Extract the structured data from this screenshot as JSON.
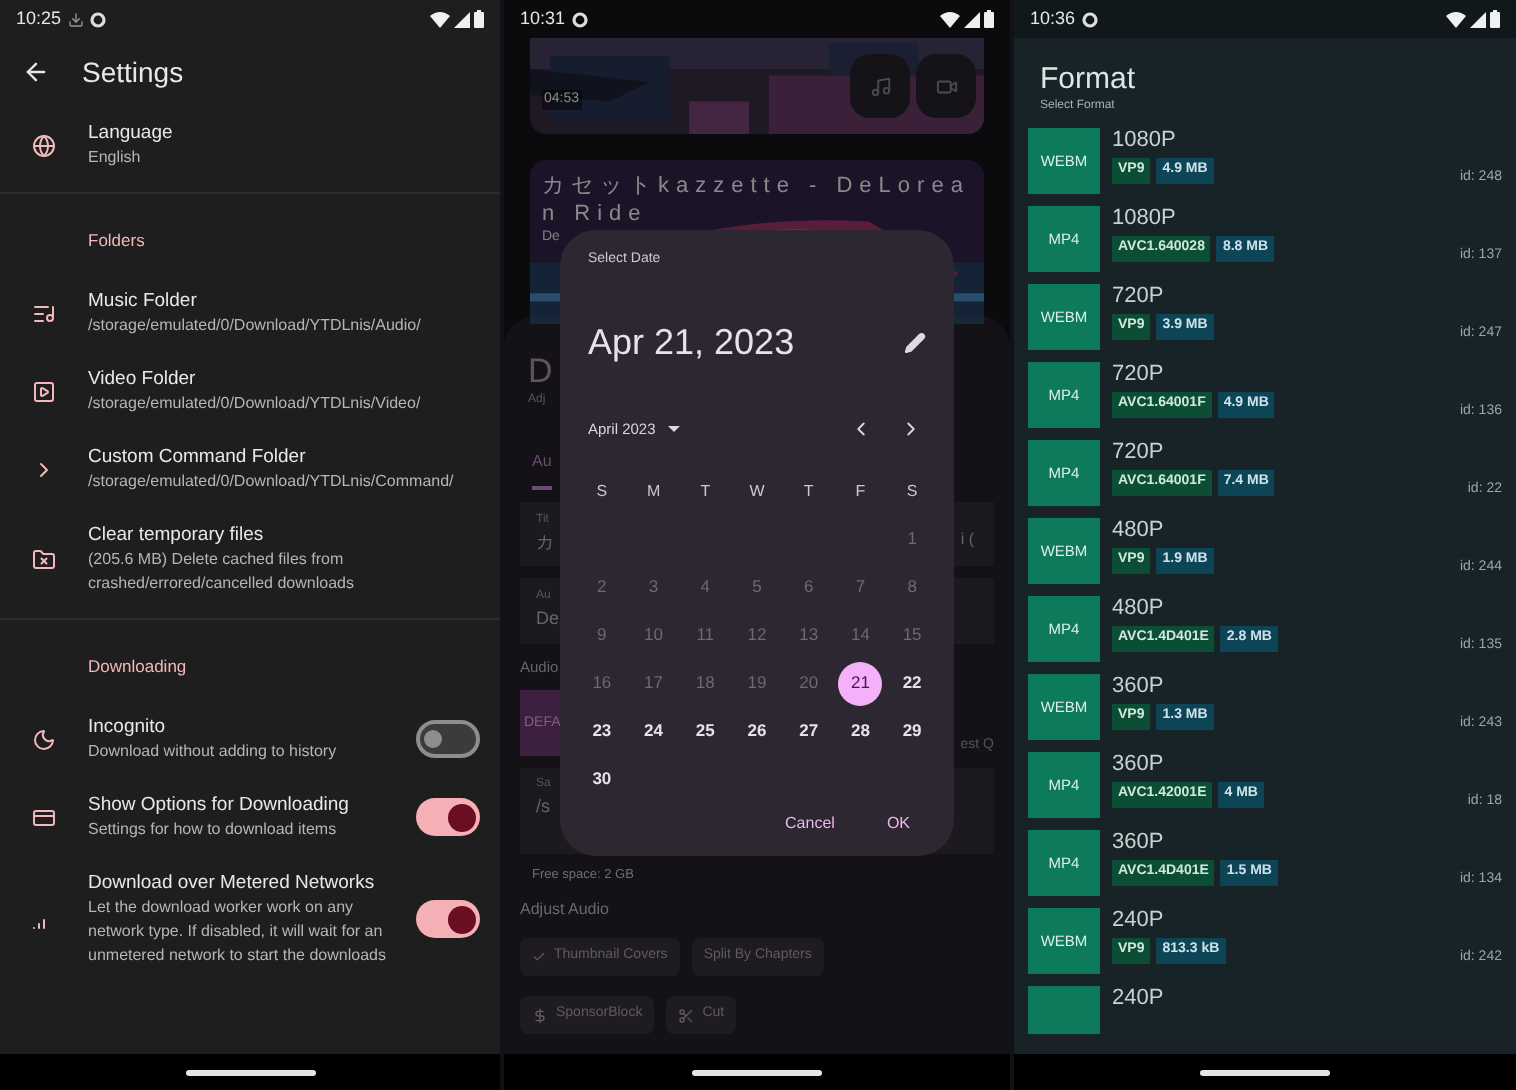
{
  "settings": {
    "time": "10:25",
    "title": "Settings",
    "items": [
      {
        "kind": "pref",
        "title": "Language",
        "subtitle": "English"
      },
      {
        "kind": "header",
        "title": "Folders"
      },
      {
        "kind": "pref",
        "title": "Music Folder",
        "subtitle": "/storage/emulated/0/Download/YTDLnis/Audio/"
      },
      {
        "kind": "pref",
        "title": "Video Folder",
        "subtitle": "/storage/emulated/0/Download/YTDLnis/Video/"
      },
      {
        "kind": "pref",
        "title": "Custom Command Folder",
        "subtitle": "/storage/emulated/0/Download/YTDLnis/Command/"
      },
      {
        "kind": "pref",
        "title": "Clear temporary files",
        "subtitle": "(205.6 MB) Delete cached files from crashed/errored/cancelled downloads"
      },
      {
        "kind": "header",
        "title": "Downloading"
      },
      {
        "kind": "switch",
        "title": "Incognito",
        "subtitle": "Download without adding to history",
        "on": false
      },
      {
        "kind": "switch",
        "title": "Show Options for Downloading",
        "subtitle": "Settings for how to download items",
        "on": true
      },
      {
        "kind": "switch",
        "title": "Download over Metered Networks",
        "subtitle": "Let the download worker work on any network type. If disabled, it will wait for an unmetered network to start the downloads",
        "on": true
      }
    ]
  },
  "downloader": {
    "time": "10:31",
    "duration": "04:53",
    "video_title": "カセットkazzette - DeLorean Ride",
    "channel": "De",
    "sheet": {
      "title": "D",
      "subtitle": "Adj",
      "tab": "Au",
      "title_label": "Tit",
      "title_value": "カ",
      "title_value_end": "i (",
      "type_label": "Au",
      "type_value": "De",
      "audio_label": "Audio",
      "format_chip": "DEFA",
      "format_end": "est Q",
      "save_label": "Sa",
      "save_value": "/s",
      "free_space": "Free space: 2 GB",
      "section": "Adjust Audio",
      "chips": [
        {
          "kind": "filter",
          "label": "Thumbnail Covers",
          "checked": true
        },
        {
          "kind": "filter",
          "label": "Split By Chapters",
          "checked": false
        },
        {
          "kind": "action",
          "label": "SponsorBlock"
        },
        {
          "kind": "action",
          "label": "Cut"
        }
      ]
    },
    "dialog": {
      "label": "Select Date",
      "date": "Apr 21, 2023",
      "month": "April 2023",
      "weekdays": [
        "S",
        "M",
        "T",
        "W",
        "T",
        "F",
        "S"
      ],
      "weeks": [
        [
          {
            "day": "1",
            "disabled": true,
            "selected": false
          }
        ],
        [
          {
            "day": "2",
            "disabled": true,
            "selected": false
          },
          {
            "day": "3",
            "disabled": true,
            "selected": false
          },
          {
            "day": "4",
            "disabled": true,
            "selected": false
          },
          {
            "day": "5",
            "disabled": true,
            "selected": false
          },
          {
            "day": "6",
            "disabled": true,
            "selected": false
          },
          {
            "day": "7",
            "disabled": true,
            "selected": false
          },
          {
            "day": "8",
            "disabled": true,
            "selected": false
          }
        ],
        [
          {
            "day": "9",
            "disabled": true,
            "selected": false
          },
          {
            "day": "10",
            "disabled": true,
            "selected": false
          },
          {
            "day": "11",
            "disabled": true,
            "selected": false
          },
          {
            "day": "12",
            "disabled": true,
            "selected": false
          },
          {
            "day": "13",
            "disabled": true,
            "selected": false
          },
          {
            "day": "14",
            "disabled": true,
            "selected": false
          },
          {
            "day": "15",
            "disabled": true,
            "selected": false
          }
        ],
        [
          {
            "day": "16",
            "disabled": true,
            "selected": false
          },
          {
            "day": "17",
            "disabled": true,
            "selected": false
          },
          {
            "day": "18",
            "disabled": true,
            "selected": false
          },
          {
            "day": "19",
            "disabled": true,
            "selected": false
          },
          {
            "day": "20",
            "disabled": true,
            "selected": false
          },
          {
            "day": "21",
            "disabled": false,
            "selected": true
          },
          {
            "day": "22",
            "disabled": false,
            "selected": false
          }
        ],
        [
          {
            "day": "23",
            "disabled": false,
            "selected": false
          },
          {
            "day": "24",
            "disabled": false,
            "selected": false
          },
          {
            "day": "25",
            "disabled": false,
            "selected": false
          },
          {
            "day": "26",
            "disabled": false,
            "selected": false
          },
          {
            "day": "27",
            "disabled": false,
            "selected": false
          },
          {
            "day": "28",
            "disabled": false,
            "selected": false
          },
          {
            "day": "29",
            "disabled": false,
            "selected": false
          }
        ],
        [
          {
            "day": "30",
            "disabled": false,
            "selected": false
          }
        ]
      ],
      "actions": [
        "Cancel",
        "OK"
      ]
    }
  },
  "formats": {
    "time": "10:36",
    "title": "Format",
    "subtitle": "Select Format",
    "items": [
      {
        "container": "WEBM",
        "quality": "1080P",
        "codec": "VP9",
        "size": "4.9 MB",
        "id": "id: 248"
      },
      {
        "container": "MP4",
        "quality": "1080P",
        "codec": "AVC1.640028",
        "size": "8.8 MB",
        "id": "id: 137"
      },
      {
        "container": "WEBM",
        "quality": "720P",
        "codec": "VP9",
        "size": "3.9 MB",
        "id": "id: 247"
      },
      {
        "container": "MP4",
        "quality": "720P",
        "codec": "AVC1.64001F",
        "size": "4.9 MB",
        "id": "id: 136"
      },
      {
        "container": "MP4",
        "quality": "720P",
        "codec": "AVC1.64001F",
        "size": "7.4 MB",
        "id": "id: 22"
      },
      {
        "container": "WEBM",
        "quality": "480P",
        "codec": "VP9",
        "size": "1.9 MB",
        "id": "id: 244"
      },
      {
        "container": "MP4",
        "quality": "480P",
        "codec": "AVC1.4D401E",
        "size": "2.8 MB",
        "id": "id: 135"
      },
      {
        "container": "WEBM",
        "quality": "360P",
        "codec": "VP9",
        "size": "1.3 MB",
        "id": "id: 243"
      },
      {
        "container": "MP4",
        "quality": "360P",
        "codec": "AVC1.42001E",
        "size": "4 MB",
        "id": "id: 18"
      },
      {
        "container": "MP4",
        "quality": "360P",
        "codec": "AVC1.4D401E",
        "size": "1.5 MB",
        "id": "id: 134"
      },
      {
        "container": "WEBM",
        "quality": "240P",
        "codec": "VP9",
        "size": "813.3 kB",
        "id": "id: 242"
      },
      {
        "quality": "240P"
      }
    ]
  }
}
